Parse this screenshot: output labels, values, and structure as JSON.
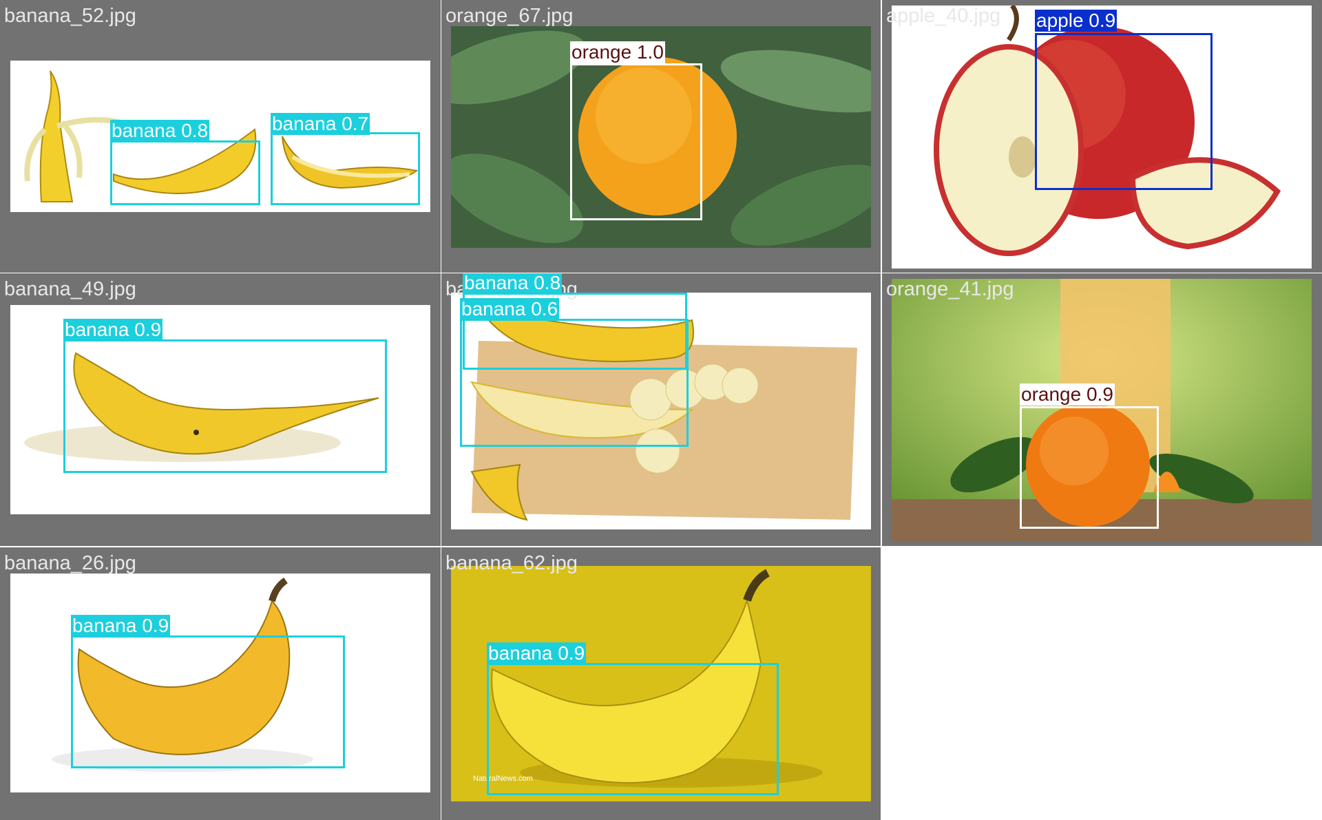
{
  "colors": {
    "banana": "#1ccfdd",
    "orange": "#ffffff",
    "apple": "#0a2fcc",
    "tile_background": "#727272"
  },
  "tiles": [
    {
      "filename": "banana_52.jpg",
      "detections": [
        {
          "label": "banana 0.8",
          "class": "banana",
          "confidence": 0.8
        },
        {
          "label": "banana 0.7",
          "class": "banana",
          "confidence": 0.7
        }
      ]
    },
    {
      "filename": "orange_67.jpg",
      "detections": [
        {
          "label": "orange 1.0",
          "class": "orange",
          "confidence": 1.0
        }
      ]
    },
    {
      "filename": "apple_40.jpg",
      "detections": [
        {
          "label": "apple 0.9",
          "class": "apple",
          "confidence": 0.9
        }
      ]
    },
    {
      "filename": "banana_49.jpg",
      "detections": [
        {
          "label": "banana 0.9",
          "class": "banana",
          "confidence": 0.9
        }
      ]
    },
    {
      "filename": "banana_??.jpg",
      "detections": [
        {
          "label": "banana 0.8",
          "class": "banana",
          "confidence": 0.8
        },
        {
          "label": "banana 0.6",
          "class": "banana",
          "confidence": 0.6
        }
      ]
    },
    {
      "filename": "orange_41.jpg",
      "detections": [
        {
          "label": "orange 0.9",
          "class": "orange",
          "confidence": 0.9
        }
      ]
    },
    {
      "filename": "banana_26.jpg",
      "detections": [
        {
          "label": "banana 0.9",
          "class": "banana",
          "confidence": 0.9
        }
      ]
    },
    {
      "filename": "banana_62.jpg",
      "detections": [
        {
          "label": "banana 0.9",
          "class": "banana",
          "confidence": 0.9
        }
      ],
      "watermark": "NaturalNews.com"
    }
  ]
}
